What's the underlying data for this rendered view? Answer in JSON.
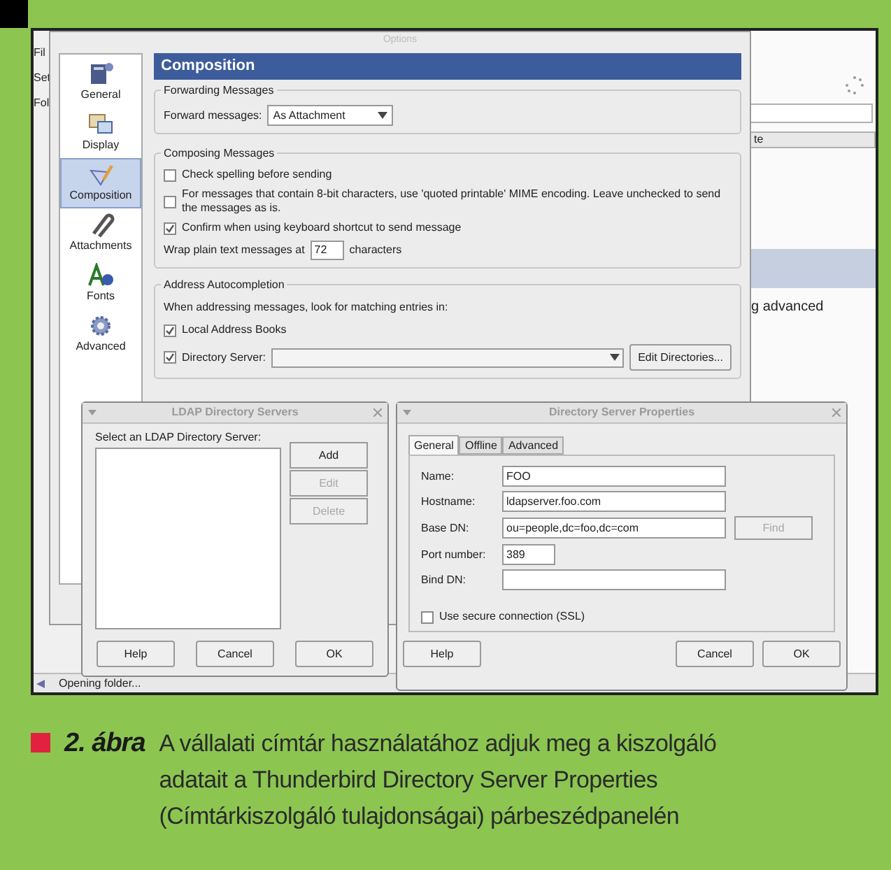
{
  "background_app": {
    "menu_fragments": [
      "Fil",
      "Set",
      "Fol"
    ],
    "column_header": "te",
    "text_fragment": "g advanced",
    "status_bar": "Opening folder..."
  },
  "options_window": {
    "title": "Options",
    "categories": [
      {
        "label": "General",
        "selected": false
      },
      {
        "label": "Display",
        "selected": false
      },
      {
        "label": "Composition",
        "selected": true
      },
      {
        "label": "Attachments",
        "selected": false
      },
      {
        "label": "Fonts",
        "selected": false
      },
      {
        "label": "Advanced",
        "selected": false
      }
    ],
    "panel_title": "Composition",
    "forwarding": {
      "title": "Forwarding Messages",
      "label": "Forward messages:",
      "value": "As Attachment"
    },
    "composing": {
      "title": "Composing Messages",
      "options": [
        {
          "label": "Check spelling before sending",
          "checked": false
        },
        {
          "label": "For messages that contain 8-bit characters, use 'quoted printable' MIME encoding. Leave unchecked to send the messages as is.",
          "checked": false
        },
        {
          "label": "Confirm when using keyboard shortcut to send message",
          "checked": true
        }
      ],
      "wrap_label": "Wrap plain text messages at",
      "wrap_value": "72",
      "wrap_unit": "characters"
    },
    "autocompletion": {
      "title": "Address Autocompletion",
      "intro": "When addressing messages, look for matching entries in:",
      "local": {
        "label": "Local Address Books",
        "checked": true
      },
      "directory": {
        "label": "Directory Server:",
        "checked": true
      },
      "edit_button": "Edit Directories..."
    }
  },
  "ldap_window": {
    "title": "LDAP Directory Servers",
    "list_label": "Select an LDAP Directory Server:",
    "side_buttons": [
      {
        "label": "Add",
        "disabled": false
      },
      {
        "label": "Edit",
        "disabled": true
      },
      {
        "label": "Delete",
        "disabled": true
      }
    ],
    "buttons": [
      "Help",
      "Cancel",
      "OK"
    ]
  },
  "properties_window": {
    "title": "Directory Server Properties",
    "tabs": [
      {
        "label": "General",
        "selected": true
      },
      {
        "label": "Offline",
        "selected": false
      },
      {
        "label": "Advanced",
        "selected": false
      }
    ],
    "fields": [
      {
        "label": "Name:",
        "value": "FOO"
      },
      {
        "label": "Hostname:",
        "value": "ldapserver.foo.com"
      },
      {
        "label": "Base DN:",
        "value": "ou=people,dc=foo,dc=com"
      },
      {
        "label": "Port number:",
        "value": "389"
      },
      {
        "label": "Bind DN:"
      }
    ],
    "find_button": {
      "label": "Find",
      "disabled": true
    },
    "ssl": {
      "label": "Use secure connection (SSL)",
      "checked": false
    },
    "buttons": [
      "Help",
      "Cancel",
      "OK"
    ]
  },
  "caption": {
    "figure_label": "2. ábra",
    "text": "A vállalati címtár használatához adjuk meg a kiszolgáló adatait a Thunderbird Directory Server Properties (Címtárkiszolgáló tulajdonságai) párbeszédpanelén"
  }
}
